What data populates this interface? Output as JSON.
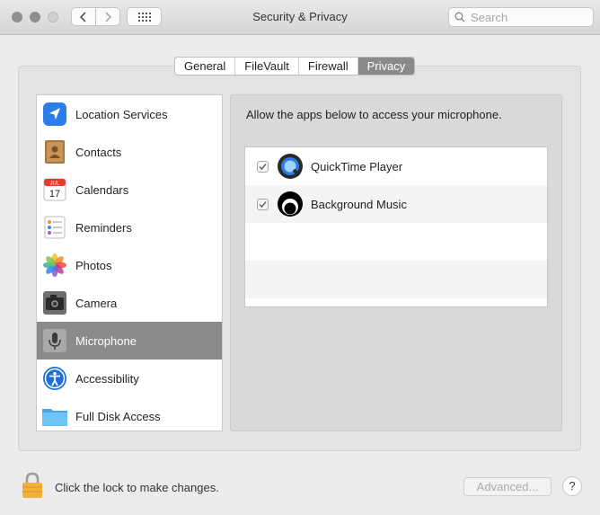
{
  "window": {
    "title": "Security & Privacy",
    "search_placeholder": "Search"
  },
  "tabs": [
    {
      "label": "General",
      "active": false
    },
    {
      "label": "FileVault",
      "active": false
    },
    {
      "label": "Firewall",
      "active": false
    },
    {
      "label": "Privacy",
      "active": true
    }
  ],
  "sidebar": {
    "items": [
      {
        "label": "Location Services",
        "icon": "location-arrow-icon"
      },
      {
        "label": "Contacts",
        "icon": "contacts-book-icon"
      },
      {
        "label": "Calendars",
        "icon": "calendar-icon",
        "icon_month": "JUL",
        "icon_day": "17"
      },
      {
        "label": "Reminders",
        "icon": "reminders-list-icon"
      },
      {
        "label": "Photos",
        "icon": "photos-flower-icon"
      },
      {
        "label": "Camera",
        "icon": "camera-icon"
      },
      {
        "label": "Microphone",
        "icon": "microphone-icon",
        "selected": true
      },
      {
        "label": "Accessibility",
        "icon": "accessibility-icon"
      },
      {
        "label": "Full Disk Access",
        "icon": "folder-icon"
      }
    ]
  },
  "main": {
    "description": "Allow the apps below to access your microphone.",
    "apps": [
      {
        "name": "QuickTime Player",
        "checked": true,
        "icon": "quicktime-icon"
      },
      {
        "name": "Background Music",
        "checked": true,
        "icon": "background-music-icon"
      }
    ]
  },
  "footer": {
    "lock_text": "Click the lock to make changes.",
    "advanced_label": "Advanced...",
    "help_label": "?"
  },
  "colors": {
    "selected_row": "#8b8b8b",
    "active_tab": "#8a8a8a",
    "lock_gold": "#f2b13c"
  }
}
